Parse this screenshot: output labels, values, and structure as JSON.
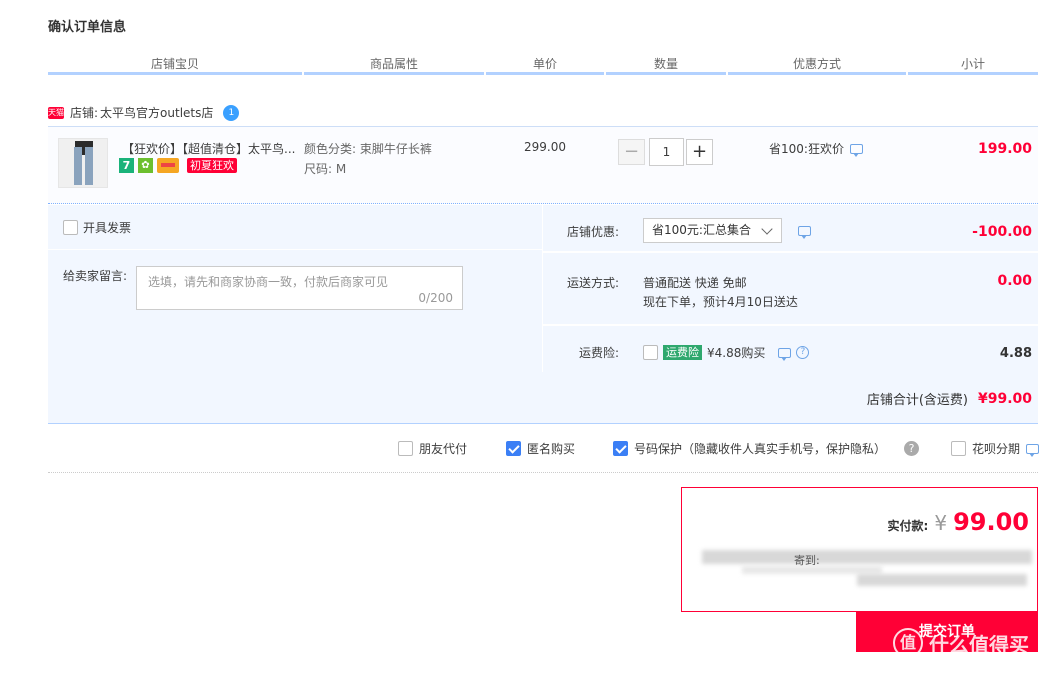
{
  "page": {
    "title": "确认订单信息"
  },
  "columns": [
    "店铺宝贝",
    "商品属性",
    "单价",
    "数量",
    "优惠方式",
    "小计"
  ],
  "shop": {
    "tmall_badge": "天猫",
    "label": "店铺:",
    "name": "太平鸟官方outlets店",
    "wangwang_badge": "1"
  },
  "item": {
    "title": "【狂欢价】【超值清仓】太平鸟...",
    "badge_7": "7",
    "badge_red": "初夏狂欢",
    "attr_color": "颜色分类:  束脚牛仔长裤",
    "attr_size": "尺码:  M",
    "price": "299.00",
    "quantity": "1",
    "minus": "−",
    "plus": "+",
    "promo": "省100:狂欢价",
    "subtotal": "199.00"
  },
  "invoice": {
    "label": "开具发票"
  },
  "memo": {
    "label": "给卖家留言:",
    "placeholder": "选填，请先和商家协商一致，付款后商家可见",
    "counter": "0/200"
  },
  "shop_discount": {
    "label": "店铺优惠:",
    "selected": "省100元:汇总集合",
    "value": "-100.00"
  },
  "shipping": {
    "label": "运送方式:",
    "method": "普通配送 快递 免邮",
    "eta": "现在下单，预计4月10日送达",
    "value": "0.00"
  },
  "insurance": {
    "label": "运费险:",
    "badge": "运费险",
    "price_text": "¥4.88购买",
    "q": "?",
    "value": "4.88"
  },
  "shop_total": {
    "label": "店铺合计(含运费)",
    "value": "¥99.00"
  },
  "options": {
    "friend_pay": "朋友代付",
    "anonymous": "匿名购买",
    "number_protect": "号码保护（隐藏收件人真实手机号，保护隐私）",
    "q": "?",
    "huabei": "花呗分期"
  },
  "payment": {
    "label": "实付款:",
    "currency": "¥",
    "amount": "99.00",
    "masked_text": "寄到:"
  },
  "submit": {
    "label": "提交订单"
  },
  "watermark": {
    "logo": "值",
    "text": "什么值得买"
  }
}
